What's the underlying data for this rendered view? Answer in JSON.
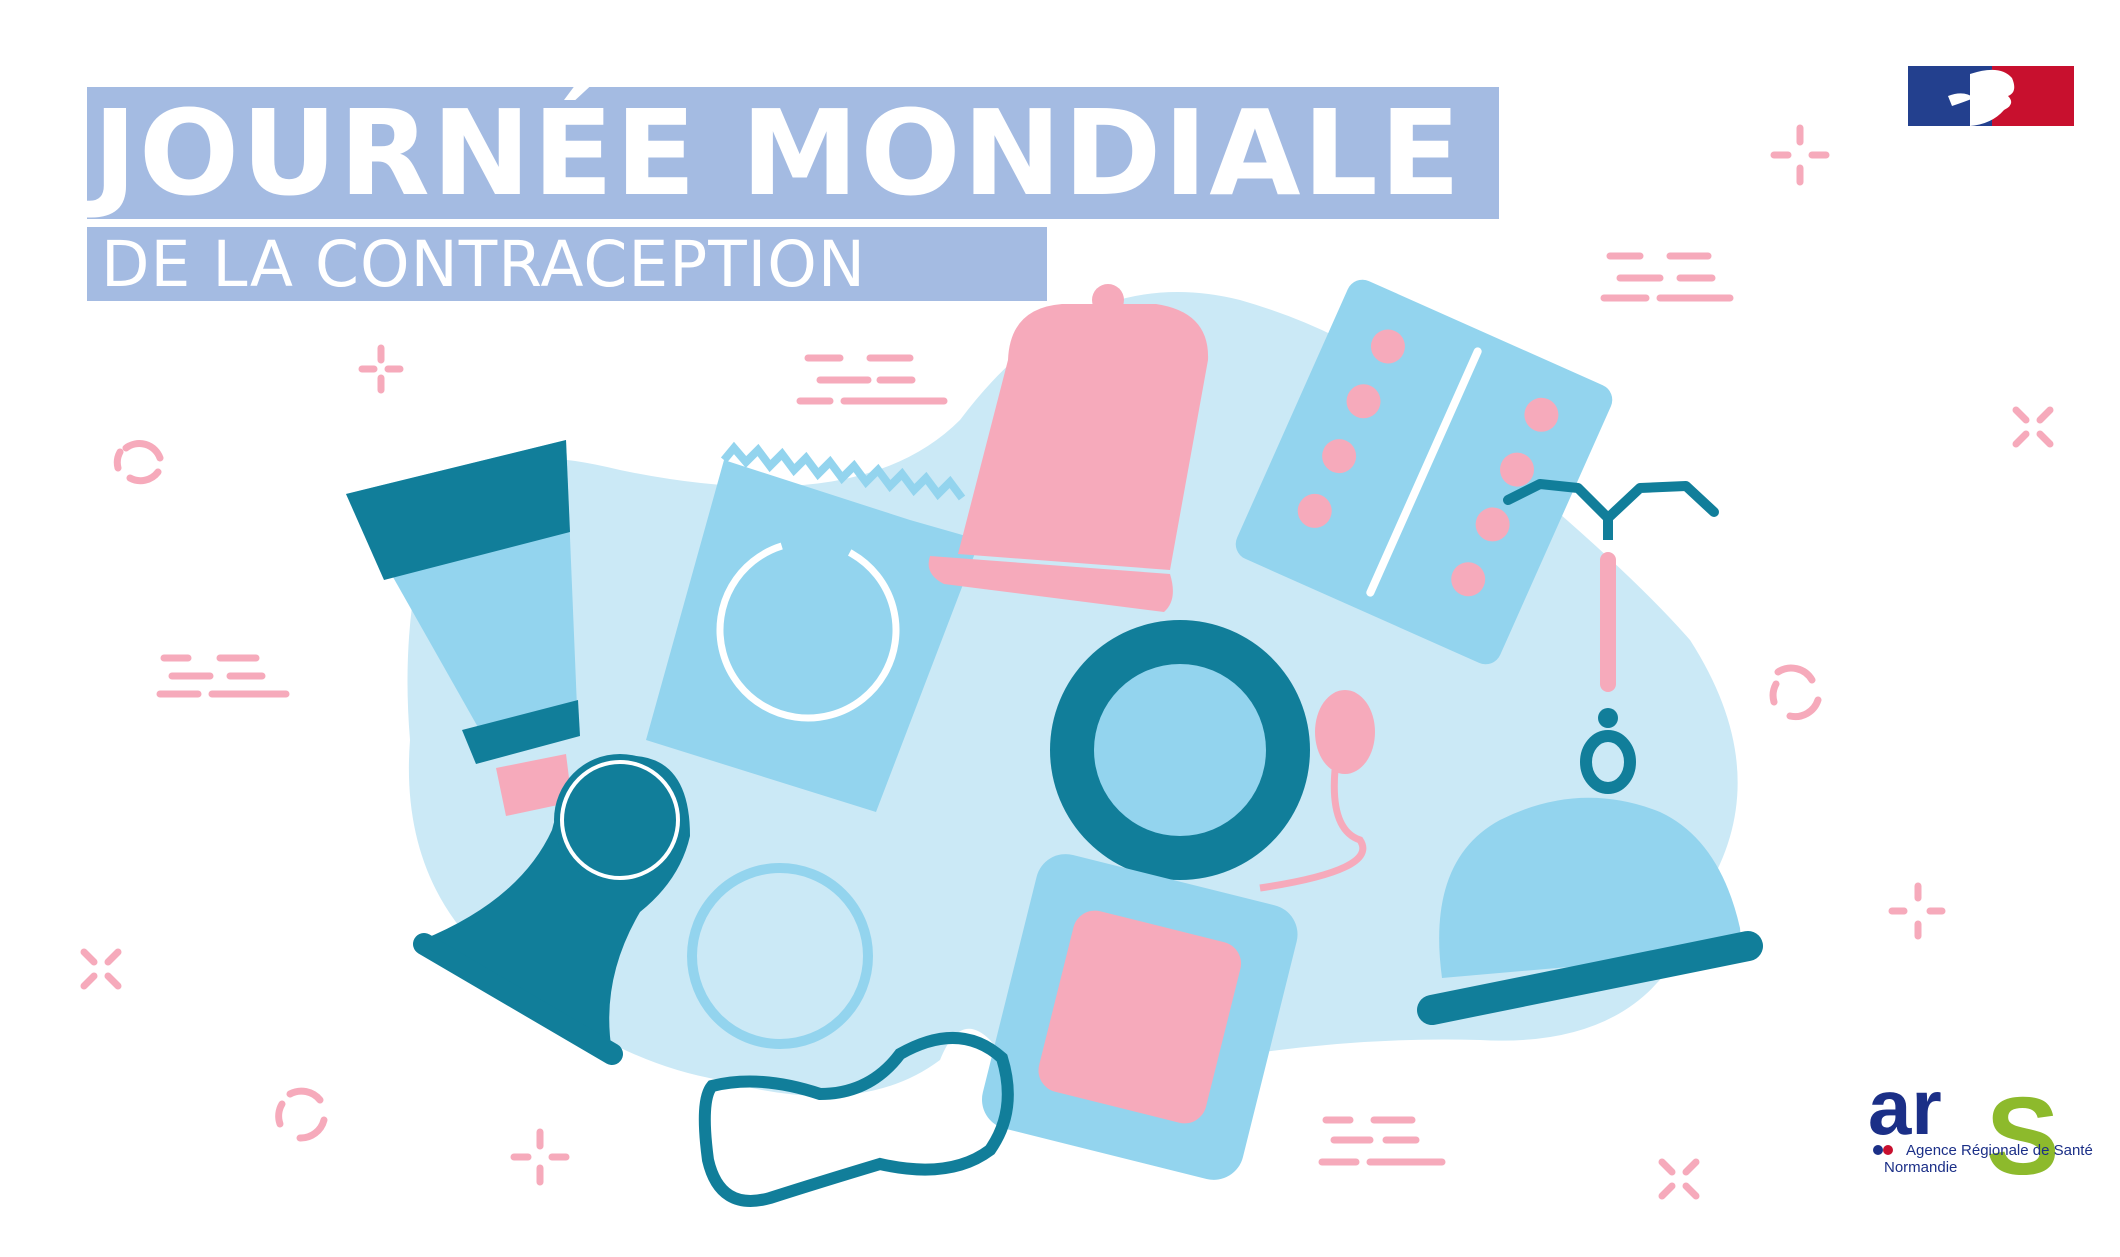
{
  "banner": {
    "title": "JOURNÉE MONDIALE",
    "subtitle": "DE LA CONTRACEPTION"
  },
  "logo": {
    "wordmark_a": "ar",
    "wordmark_s": "S",
    "line1": "Agence Régionale de Santé",
    "line2": "Normandie"
  },
  "colors": {
    "title_band": "#a4bbe2",
    "pink": "#f6aabb",
    "light_blue": "#93d4ee",
    "dark_teal": "#117e9a",
    "blob": "#cbe9f6",
    "logo_navy": "#1b2f87",
    "logo_green": "#8dba2c"
  },
  "icons": [
    "tube-icon",
    "condom-packet-icon",
    "diaphragm-icon",
    "menstrual-cup-icon",
    "pill-blister-icon",
    "iud-icon",
    "vaginal-ring-icon",
    "patch-icon",
    "cervical-cap-icon",
    "female-condom-icon",
    "sponge-icon",
    "french-flag-icon"
  ]
}
